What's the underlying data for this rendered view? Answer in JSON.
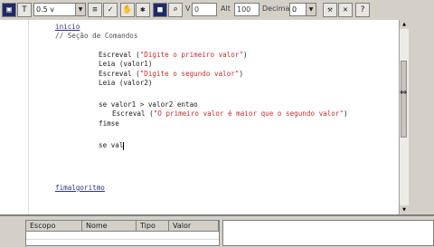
{
  "toolbar": {
    "font_size_value": "0.5 v",
    "labels": [
      "V C",
      "Alt",
      "Decimal"
    ],
    "field_values": [
      "0",
      "100",
      ""
    ],
    "decimal_value": "0"
  },
  "editor": {
    "lines": [
      {
        "text": "inicio",
        "style": "und"
      },
      {
        "text": "// Seção de Comandos",
        "style": "cm"
      },
      {
        "text": "Escreval (\"Digite o primeiro valor\")",
        "style": "mix1"
      },
      {
        "text": "Leia (valor1)",
        "style": "kw"
      },
      {
        "text": "Escreval (\"Digite o segundo valor\")",
        "style": "mix2"
      },
      {
        "text": "Leia (valor2)",
        "style": "kw"
      },
      {
        "text": "se valor1 > valor2 entao",
        "style": "kw"
      },
      {
        "text": "Escreval (\"O primeiro valor é maior que o segundo valor\")",
        "style": "mix3"
      },
      {
        "text": "fimse",
        "style": "kw"
      },
      {
        "text": "se val",
        "style": "kw"
      },
      {
        "text": "fimalgoritmo",
        "style": "und"
      }
    ],
    "escreval": "Escreval (",
    "close": ")",
    "str1": "\"Digite o primeiro valor\"",
    "str2": "\"Digite o segundo valor\"",
    "str3": "\"O primeiro valor é maior que o segundo valor\""
  },
  "variables_table": {
    "columns": [
      "Escopo",
      "Nome",
      "Tipo",
      "Valor"
    ]
  }
}
